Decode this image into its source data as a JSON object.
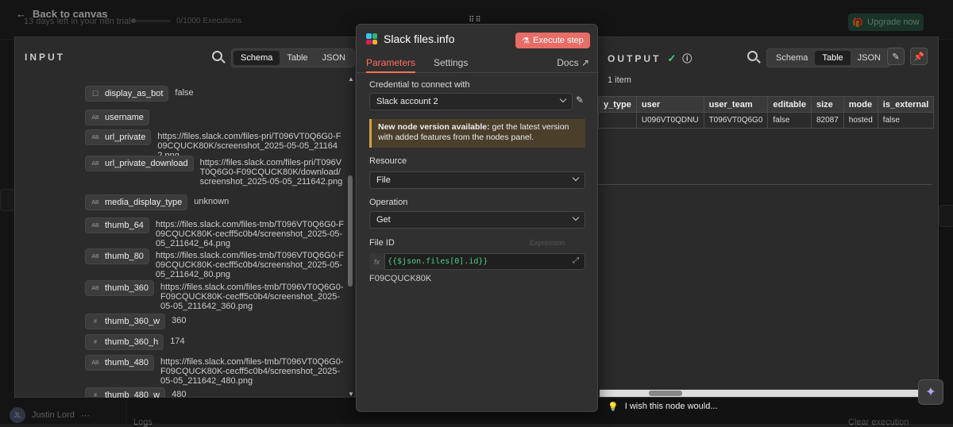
{
  "topbar": {
    "back_label": "Back to canvas",
    "trial_text": "13 days left in your n8n trial",
    "executions_text": "0/1000 Executions",
    "upgrade_label": "Upgrade now"
  },
  "footer": {
    "user_initials": "JL",
    "user_name": "Justin Lord",
    "logs_label": "Logs",
    "clear_label": "Clear execution",
    "wish_text": "I wish this node would..."
  },
  "input": {
    "title": "INPUT",
    "views": [
      "Schema",
      "Table",
      "JSON"
    ],
    "active_view": "Schema",
    "fields": [
      {
        "type": "bool",
        "name": "display_as_bot",
        "value": "false"
      },
      {
        "type": "AB",
        "name": "username",
        "value": ""
      },
      {
        "type": "AB",
        "name": "url_private",
        "value": "https://files.slack.com/files-pri/T096VT0Q6G0-F09CQUCK80K/screenshot_2025-05-05_211642.png"
      },
      {
        "type": "AB",
        "name": "url_private_download",
        "value": "https://files.slack.com/files-pri/T096VT0Q6G0-F09CQUCK80K/download/screenshot_2025-05-05_211642.png"
      },
      {
        "type": "AB",
        "name": "media_display_type",
        "value": "unknown"
      },
      {
        "type": "AB",
        "name": "thumb_64",
        "value": "https://files.slack.com/files-tmb/T096VT0Q6G0-F09CQUCK80K-cecff5c0b4/screenshot_2025-05-05_211642_64.png"
      },
      {
        "type": "AB",
        "name": "thumb_80",
        "value": "https://files.slack.com/files-tmb/T096VT0Q6G0-F09CQUCK80K-cecff5c0b4/screenshot_2025-05-05_211642_80.png"
      },
      {
        "type": "AB",
        "name": "thumb_360",
        "value": "https://files.slack.com/files-tmb/T096VT0Q6G0-F09CQUCK80K-cecff5c0b4/screenshot_2025-05-05_211642_360.png"
      },
      {
        "type": "#",
        "name": "thumb_360_w",
        "value": "360"
      },
      {
        "type": "#",
        "name": "thumb_360_h",
        "value": "174"
      },
      {
        "type": "AB",
        "name": "thumb_480",
        "value": "https://files.slack.com/files-tmb/T096VT0Q6G0-F09CQUCK80K-cecff5c0b4/screenshot_2025-05-05_211642_480.png"
      },
      {
        "type": "#",
        "name": "thumb_480_w",
        "value": "480"
      }
    ]
  },
  "node": {
    "title": "Slack files.info",
    "execute_label": "Execute step",
    "tabs": [
      "Parameters",
      "Settings"
    ],
    "active_tab": "Parameters",
    "docs_label": "Docs",
    "credential_label": "Credential to connect with",
    "credential_value": "Slack account 2",
    "notice_bold": "New node version available:",
    "notice_text": " get the latest version with added features from the nodes panel.",
    "resource_label": "Resource",
    "resource_value": "File",
    "operation_label": "Operation",
    "operation_value": "Get",
    "fileid_label": "File ID",
    "fileid_mode": "Expression",
    "fileid_expression": "{{$json.files[0].id}}",
    "fileid_result": "F09CQUCK80K"
  },
  "output": {
    "title": "OUTPUT",
    "views": [
      "Schema",
      "Table",
      "JSON"
    ],
    "active_view": "Table",
    "item_count": "1 item",
    "columns": [
      "y_type",
      "user",
      "user_team",
      "editable",
      "size",
      "mode",
      "is_external"
    ],
    "rows": [
      [
        "",
        "U096VT0QDNU",
        "T096VT0Q6G0",
        "false",
        "82087",
        "hosted",
        "false"
      ]
    ]
  }
}
